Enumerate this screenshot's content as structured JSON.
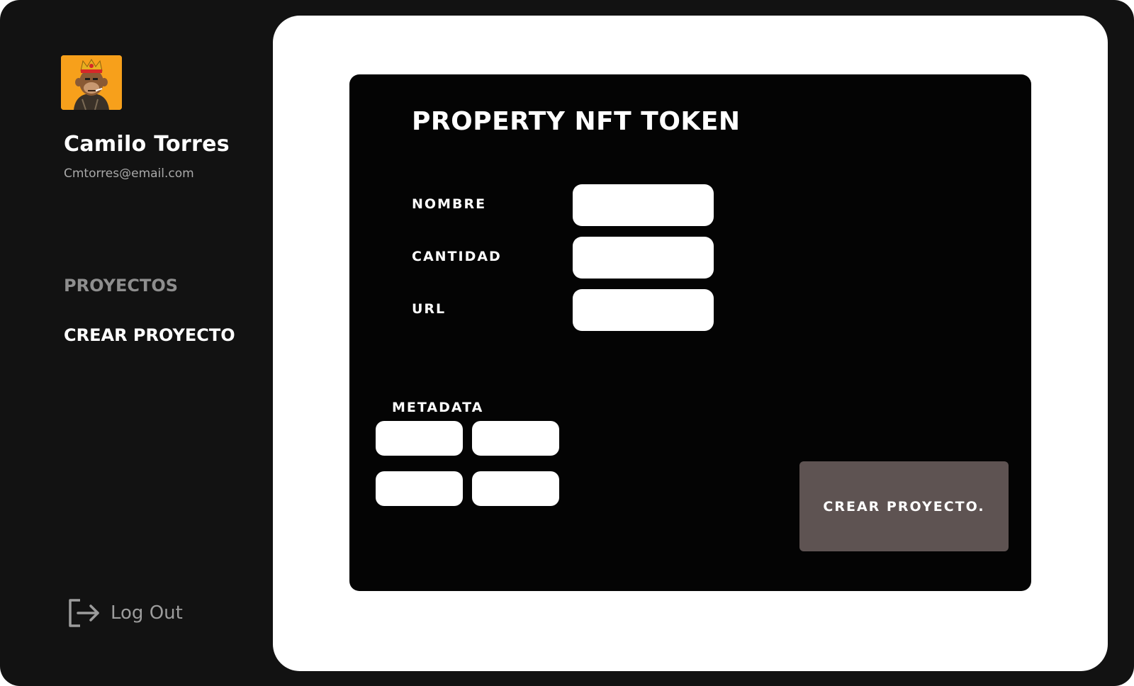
{
  "user": {
    "name": "Camilo Torres",
    "email": "Cmtorres@email.com"
  },
  "sidebar": {
    "items": [
      {
        "label": "PROYECTOS"
      },
      {
        "label": "CREAR PROYECTO"
      }
    ],
    "logout_label": "Log Out"
  },
  "form": {
    "title": "PROPERTY NFT TOKEN",
    "fields": [
      {
        "label": "NOMBRE",
        "value": ""
      },
      {
        "label": "CANTIDAD",
        "value": ""
      },
      {
        "label": "URL",
        "value": ""
      }
    ],
    "metadata_label": "METADATA",
    "metadata_values": [
      "",
      "",
      "",
      ""
    ],
    "submit_label": "CREAR PROYECTO."
  },
  "colors": {
    "frame": "#121212",
    "panel": "#ffffff",
    "card": "#040404",
    "button": "#5e5352",
    "avatar_bg": "#f7a01b",
    "nav_inactive": "#8e8e8e"
  },
  "icons": {
    "avatar": "ape-avatar-icon",
    "logout": "logout-icon"
  }
}
